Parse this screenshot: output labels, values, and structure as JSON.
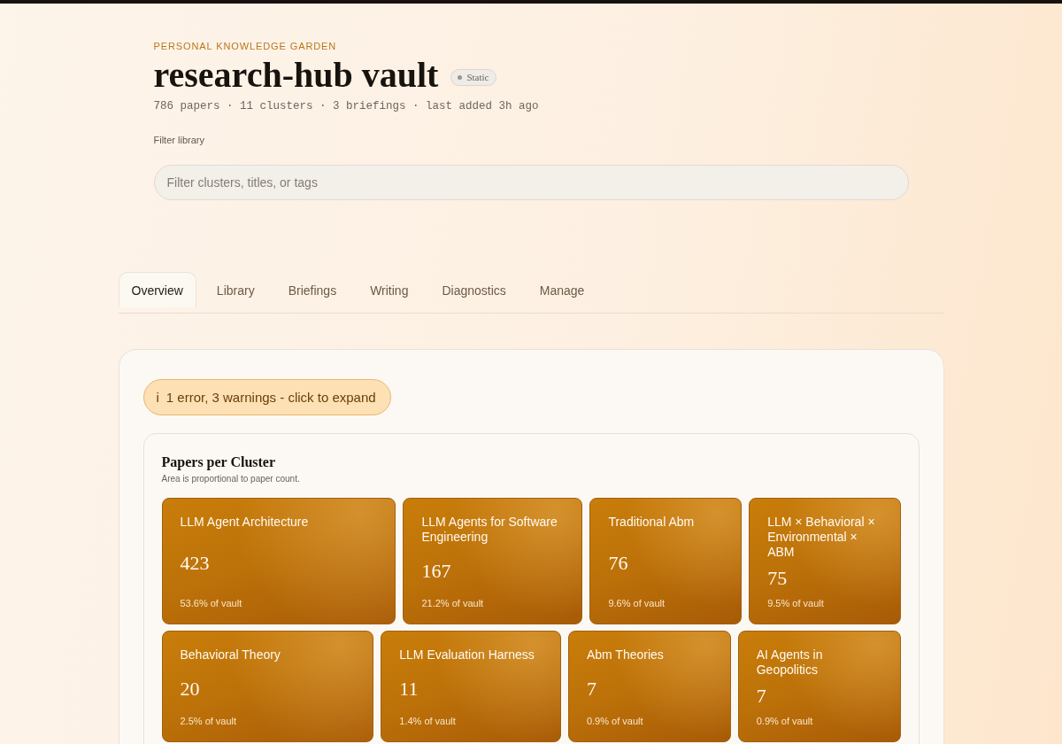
{
  "header": {
    "eyebrow": "PERSONAL KNOWLEDGE GARDEN",
    "title": "research-hub vault",
    "badge": {
      "label": "Static"
    },
    "meta": "786 papers · 11 clusters · 3 briefings · last added 3h ago"
  },
  "filter": {
    "label": "Filter library",
    "placeholder": "Filter clusters, titles, or tags"
  },
  "tabs": [
    {
      "label": "Overview",
      "selected": true
    },
    {
      "label": "Library",
      "selected": false
    },
    {
      "label": "Briefings",
      "selected": false
    },
    {
      "label": "Writing",
      "selected": false
    },
    {
      "label": "Diagnostics",
      "selected": false
    },
    {
      "label": "Manage",
      "selected": false
    }
  ],
  "alert": {
    "icon": "i",
    "text": "1 error, 3 warnings - click to expand"
  },
  "cluster_card": {
    "title": "Papers per Cluster",
    "subtitle": "Area is proportional to paper count.",
    "rows": [
      {
        "tiles": [
          {
            "name": "LLM Agent Architecture",
            "count": "423",
            "share": "53.6% of vault"
          },
          {
            "name": "LLM Agents for Software Engineering",
            "count": "167",
            "share": "21.2% of vault"
          },
          {
            "name": "Traditional Abm",
            "count": "76",
            "share": "9.6% of vault"
          },
          {
            "name": "LLM × Behavioral × Environmental × ABM",
            "count": "75",
            "share": "9.5% of vault"
          }
        ]
      },
      {
        "tiles": [
          {
            "name": "Behavioral Theory",
            "count": "20",
            "share": "2.5% of vault"
          },
          {
            "name": "LLM Evaluation Harness",
            "count": "11",
            "share": "1.4% of vault"
          },
          {
            "name": "Abm Theories",
            "count": "7",
            "share": "0.9% of vault"
          },
          {
            "name": "AI Agents in Geopolitics",
            "count": "7",
            "share": "0.9% of vault"
          }
        ]
      }
    ]
  }
}
